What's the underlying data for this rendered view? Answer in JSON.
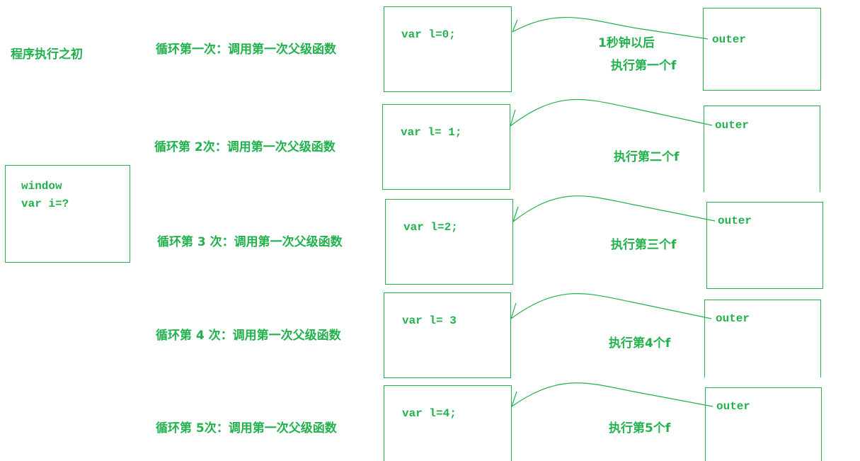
{
  "accent_color": "#22b14c",
  "intro": {
    "label": "程序执行之初",
    "window_box": {
      "title": "window",
      "line": "var i=?"
    }
  },
  "iterations": [
    {
      "loop_label": "循环第一次：调用第一次父级函数",
      "scope_code": "var l=0;",
      "outer_label": "outer",
      "delay_note": "1秒钟以后",
      "exec_label": "执行第一个f"
    },
    {
      "loop_label": "循环第 2次：调用第一次父级函数",
      "scope_code": "var l= 1;",
      "outer_label": "outer",
      "exec_label": "执行第二个f"
    },
    {
      "loop_label": "循环第 3 次：调用第一次父级函数",
      "scope_code": "var l=2;",
      "outer_label": "outer",
      "exec_label": "执行第三个f"
    },
    {
      "loop_label": "循环第 4 次：调用第一次父级函数",
      "scope_code": "var l= 3",
      "outer_label": "outer",
      "exec_label": "执行第4个f"
    },
    {
      "loop_label": "循环第 5次：调用第一次父级函数",
      "scope_code": "var l=4;",
      "outer_label": "outer",
      "exec_label": "执行第5个f"
    }
  ]
}
